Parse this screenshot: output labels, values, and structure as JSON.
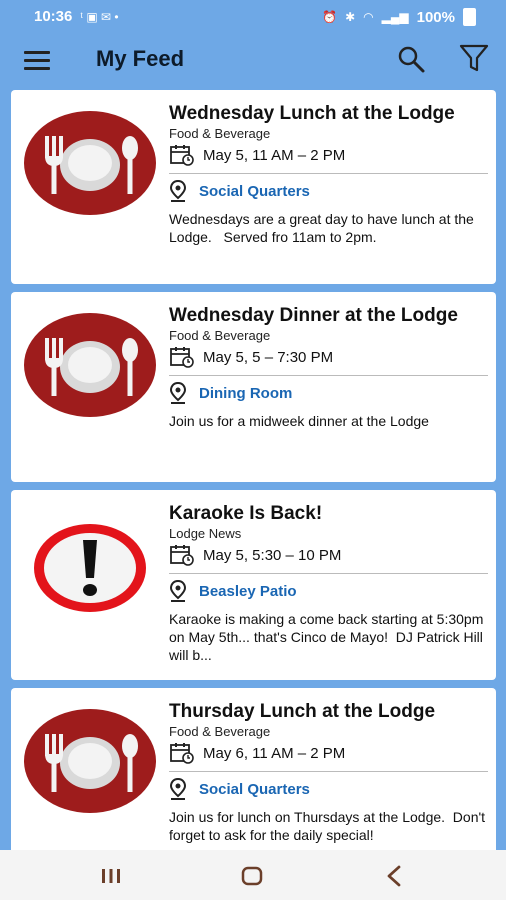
{
  "status": {
    "time": "10:36",
    "left_icons": "ᵗ",
    "battery": "100%"
  },
  "appbar": {
    "title": "My Feed",
    "icons": [
      "menu-icon",
      "search-icon",
      "filter-icon"
    ]
  },
  "feed": {
    "items": [
      {
        "title": "Wednesday Lunch at the Lodge",
        "category": "Food & Beverage",
        "date": "May 5, 11 AM – 2 PM",
        "location": "Social Quarters",
        "description": "Wednesdays are a great day to have lunch at the Lodge.   Served fro 11am to 2pm.",
        "icon": "dining-icon"
      },
      {
        "title": "Wednesday Dinner at the Lodge",
        "category": "Food & Beverage",
        "date": "May 5, 5 – 7:30 PM",
        "location": "Dining Room",
        "description": "Join us for a midweek dinner at the Lodge",
        "icon": "dining-icon"
      },
      {
        "title": "Karaoke Is Back!",
        "category": "Lodge News",
        "date": "May 5, 5:30 – 10 PM",
        "location": "Beasley Patio",
        "description": "Karaoke is making a come back starting at 5:30pm on May 5th... that's Cinco de Mayo!  DJ Patrick Hill will b...",
        "icon": "alert-icon"
      },
      {
        "title": "Thursday Lunch at the Lodge",
        "category": "Food & Beverage",
        "date": "May 6, 11 AM – 2 PM",
        "location": "Social Quarters",
        "description": "Join us for lunch on Thursdays at the Lodge.  Don't forget to ask for the daily special!",
        "icon": "dining-icon"
      }
    ]
  },
  "colors": {
    "background": "#6ea8e6",
    "card": "#ffffff",
    "location_text": "#1a66b3",
    "icon_red": "#9e1c1c"
  }
}
